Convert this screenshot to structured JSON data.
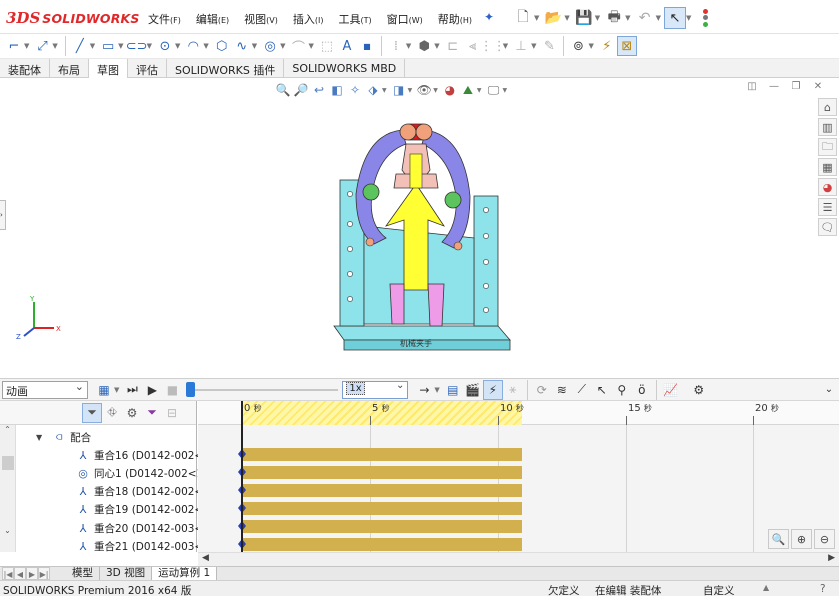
{
  "app": {
    "logo_mark": "3DS",
    "logo_text": "SOLIDWORKS"
  },
  "menu": [
    {
      "label": "文件",
      "key": "(F)"
    },
    {
      "label": "编辑",
      "key": "(E)"
    },
    {
      "label": "视图",
      "key": "(V)"
    },
    {
      "label": "插入",
      "key": "(I)"
    },
    {
      "label": "工具",
      "key": "(T)"
    },
    {
      "label": "窗口",
      "key": "(W)"
    },
    {
      "label": "帮助",
      "key": "(H)"
    }
  ],
  "command_tabs": [
    "装配体",
    "布局",
    "草图",
    "评估",
    "SOLIDWORKS 插件",
    "SOLIDWORKS MBD"
  ],
  "active_command_tab": "草图",
  "model": {
    "base_label": "机械夹手"
  },
  "triad": {
    "x": "X",
    "y": "Y",
    "z": "Z"
  },
  "motion": {
    "study_type": "动画",
    "speed": "1x",
    "timeline_ticks": [
      {
        "value": "0",
        "unit": "秒"
      },
      {
        "value": "5",
        "unit": "秒"
      },
      {
        "value": "10",
        "unit": "秒"
      },
      {
        "value": "15",
        "unit": "秒"
      },
      {
        "value": "20",
        "unit": "秒"
      }
    ]
  },
  "tree": {
    "group_label": "配合",
    "rows": [
      {
        "icon": "coincident-icon",
        "label": "重合16 (D0142-002<"
      },
      {
        "icon": "concentric-icon",
        "label": "同心1 (D0142-002<1"
      },
      {
        "icon": "coincident-icon",
        "label": "重合18 (D0142-002<"
      },
      {
        "icon": "coincident-icon",
        "label": "重合19 (D0142-002<"
      },
      {
        "icon": "coincident-icon",
        "label": "重合20 (D0142-003<"
      },
      {
        "icon": "coincident-icon",
        "label": "重合21 (D0142-003<"
      }
    ]
  },
  "bottom_tabs": [
    "模型",
    "3D 视图",
    "运动算例 1"
  ],
  "active_bottom_tab": "运动算例 1",
  "status": {
    "product": "SOLIDWORKS Premium 2016 x64 版",
    "definition": "欠定义",
    "editing": "在编辑 装配体",
    "units": "自定义"
  },
  "colors": {
    "accent_blue": "#2a79d8",
    "brand_red": "#e0282b",
    "key_bar": "#d3b04e",
    "timeline_highlight": "#ffe96a",
    "frame_cyan": "#8ee3ea",
    "arm_purple": "#8a86e8",
    "yellow_part": "#ffff33"
  }
}
